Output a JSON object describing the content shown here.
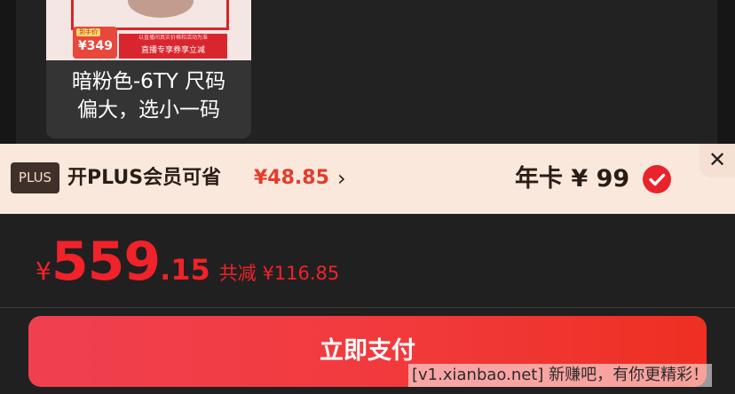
{
  "product": {
    "price_tag_label": "到手价",
    "price_tag_value": "¥349",
    "banner_small": "以直播间真实价格和活动为准",
    "banner_big": "直播专享券享立减",
    "variant_line1": "暗粉色-6TY 尺码",
    "variant_line2": "偏大，选小一码"
  },
  "plus": {
    "badge": "PLUS",
    "text": "开PLUS会员可省",
    "saving": "¥48.85",
    "chevron": "›",
    "annual": "年卡 ¥ 99",
    "close": "✕"
  },
  "checkout": {
    "currency": "¥",
    "price_int": "559",
    "price_dec": ".15",
    "discount": "共减 ¥116.85",
    "pay_label": "立即支付"
  },
  "watermark": "[v1.xianbao.net] 新赚吧，有你更精彩！",
  "colors": {
    "accent_red": "#f0222a",
    "plus_bar_bg": "#fbe8dc",
    "dark_bg": "#202020"
  }
}
